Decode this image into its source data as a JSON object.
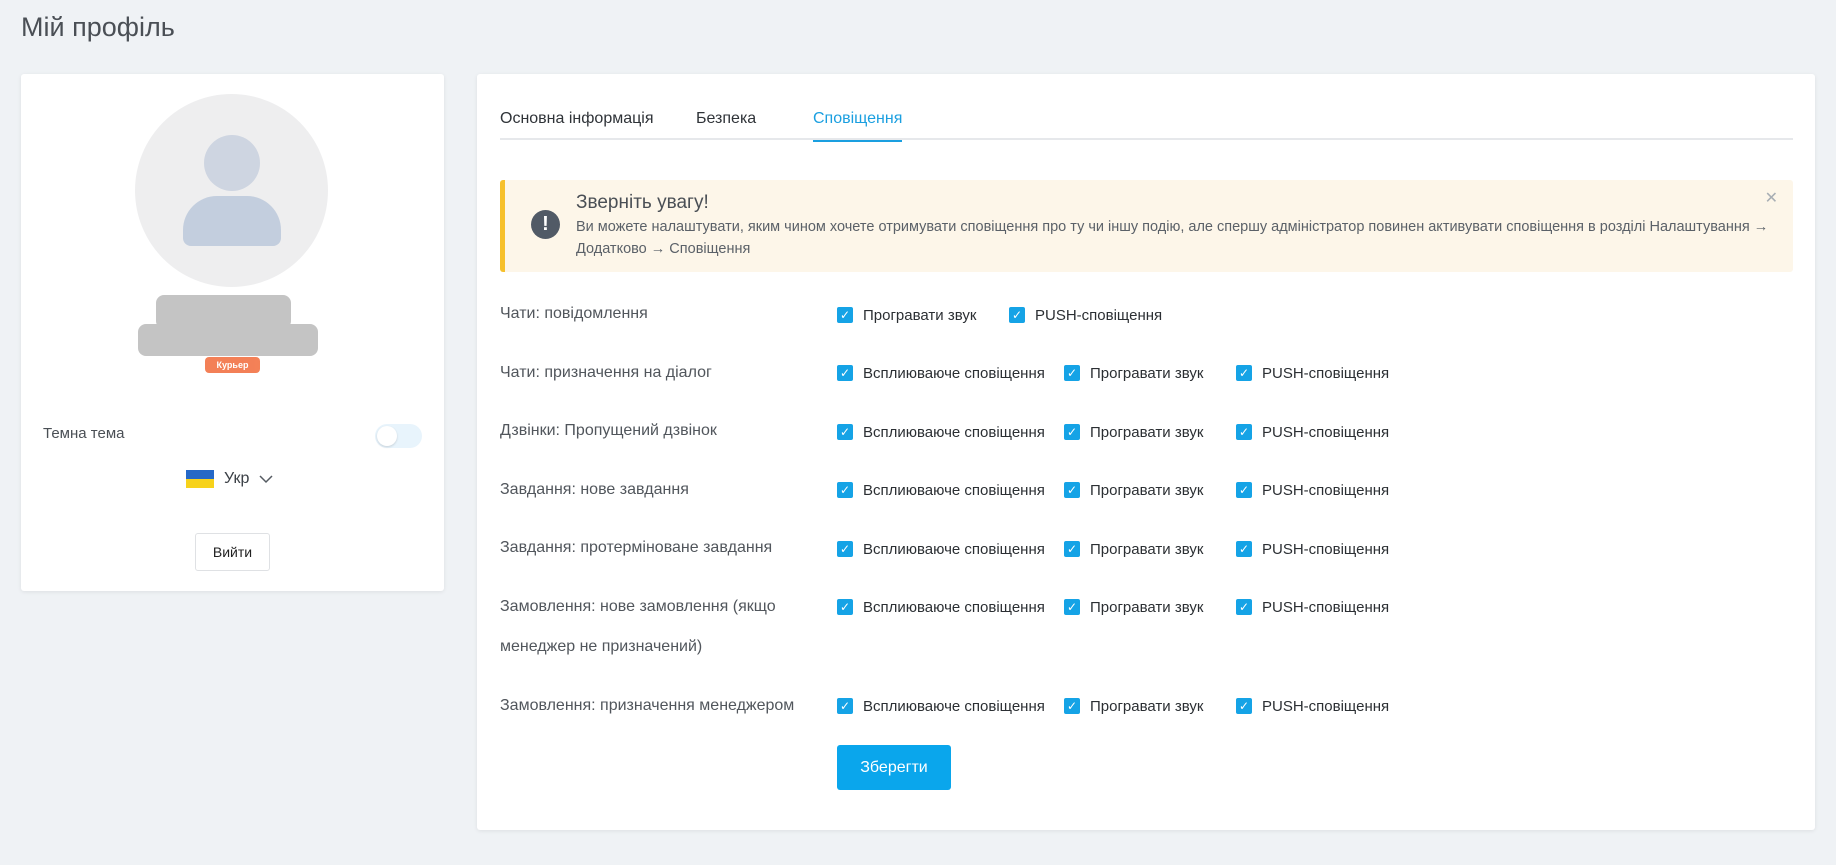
{
  "page": {
    "title": "Мій профіль"
  },
  "profile": {
    "role_badge": "Курьер",
    "theme_label": "Темна тема",
    "language": "Укр",
    "logout_label": "Вийти"
  },
  "tabs": [
    {
      "label": "Основна інформація",
      "active": false
    },
    {
      "label": "Безпека",
      "active": false
    },
    {
      "label": "Сповіщення",
      "active": true
    }
  ],
  "alert": {
    "title": "Зверніть увагу!",
    "text": "Ви можете налаштувати, яким чином хочете отримувати сповіщення про ту чи іншу подію, але спершу адміністратор повинен активувати сповіщення в розділі Налаштування → Додатково → Сповіщення"
  },
  "options": {
    "popup": "Всплиюваюче сповіщення",
    "sound": "Програвати звук",
    "push": "PUSH-сповіщення"
  },
  "rows": [
    {
      "label": "Чати: повідомлення"
    },
    {
      "label": "Чати: призначення на діалог"
    },
    {
      "label": "Дзвінки: Пропущений дзвінок"
    },
    {
      "label": "Завдання: нове завдання"
    },
    {
      "label": "Завдання: протерміноване завдання"
    },
    {
      "label": "Замовлення: нове замовлення (якщо менеджер не призначений)"
    },
    {
      "label": "Замовлення: призначення менеджером"
    }
  ],
  "save_label": "Зберегти",
  "colors": {
    "accent": "#0aa6ec",
    "alert_border": "#f6c02c",
    "badge": "#f26b3a"
  }
}
